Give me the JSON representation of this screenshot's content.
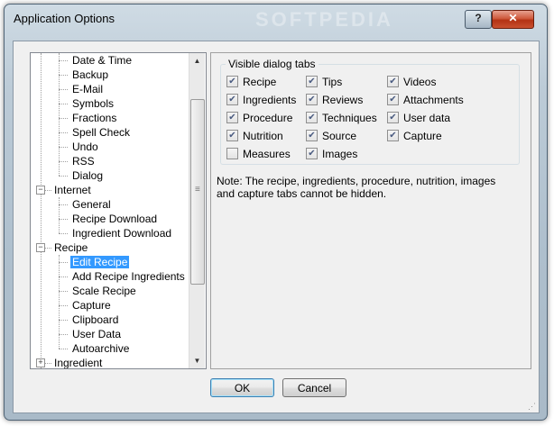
{
  "window": {
    "title": "Application Options",
    "watermark": "SOFTPEDIA",
    "help": "?",
    "close": "✕"
  },
  "tree": {
    "items": [
      {
        "label": "Date & Time",
        "level": 2
      },
      {
        "label": "Backup",
        "level": 2
      },
      {
        "label": "E-Mail",
        "level": 2
      },
      {
        "label": "Symbols",
        "level": 2
      },
      {
        "label": "Fractions",
        "level": 2
      },
      {
        "label": "Spell Check",
        "level": 2
      },
      {
        "label": "Undo",
        "level": 2
      },
      {
        "label": "RSS",
        "level": 2
      },
      {
        "label": "Dialog",
        "level": 2
      },
      {
        "label": "Internet",
        "level": 1,
        "expander": "−"
      },
      {
        "label": "General",
        "level": 2
      },
      {
        "label": "Recipe Download",
        "level": 2
      },
      {
        "label": "Ingredient Download",
        "level": 2
      },
      {
        "label": "Recipe",
        "level": 1,
        "expander": "−"
      },
      {
        "label": "Edit Recipe",
        "level": 2,
        "selected": true
      },
      {
        "label": "Add Recipe Ingredients",
        "level": 2
      },
      {
        "label": "Scale Recipe",
        "level": 2
      },
      {
        "label": "Capture",
        "level": 2
      },
      {
        "label": "Clipboard",
        "level": 2
      },
      {
        "label": "User Data",
        "level": 2
      },
      {
        "label": "Autoarchive",
        "level": 2
      },
      {
        "label": "Ingredient",
        "level": 1,
        "expander": "+"
      }
    ],
    "scroll_up": "▲",
    "scroll_down": "▼"
  },
  "panel": {
    "group_title": "Visible dialog tabs",
    "checkboxes": [
      {
        "label": "Recipe",
        "checked": true
      },
      {
        "label": "Tips",
        "checked": true
      },
      {
        "label": "Videos",
        "checked": true
      },
      {
        "label": "Ingredients",
        "checked": true
      },
      {
        "label": "Reviews",
        "checked": true
      },
      {
        "label": "Attachments",
        "checked": true
      },
      {
        "label": "Procedure",
        "checked": true
      },
      {
        "label": "Techniques",
        "checked": true
      },
      {
        "label": "User data",
        "checked": true
      },
      {
        "label": "Nutrition",
        "checked": true
      },
      {
        "label": "Source",
        "checked": true
      },
      {
        "label": "Capture",
        "checked": true
      },
      {
        "label": "Measures",
        "checked": false
      },
      {
        "label": "Images",
        "checked": true
      }
    ],
    "note": "Note: The recipe, ingredients, procedure, nutrition, images and capture tabs cannot be hidden."
  },
  "buttons": {
    "ok": "OK",
    "cancel": "Cancel"
  }
}
